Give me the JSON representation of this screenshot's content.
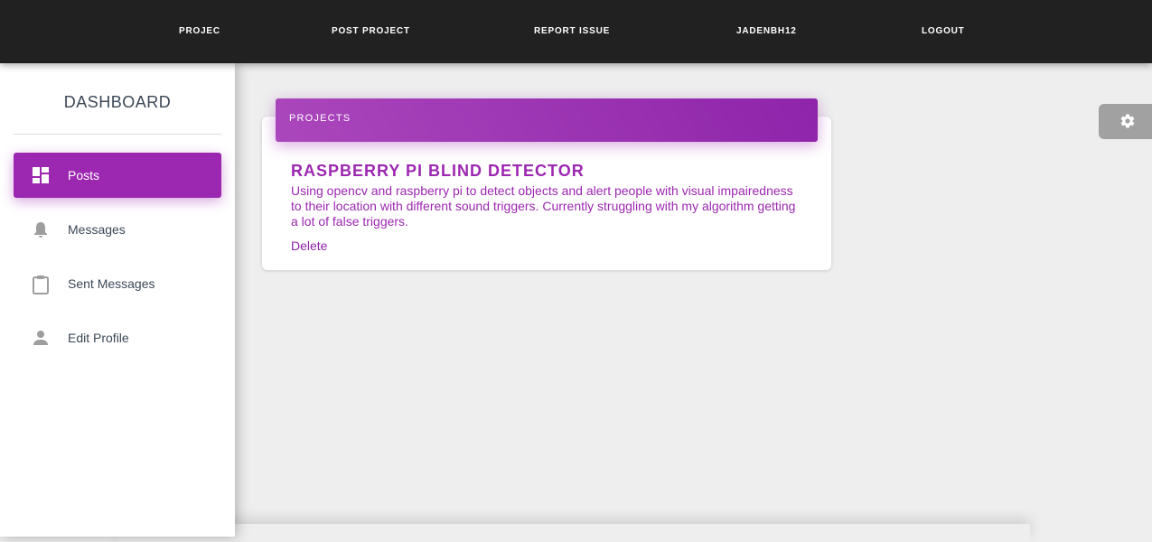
{
  "topnav": {
    "items": [
      "PROJEC",
      "POST PROJECT",
      "REPORT ISSUE",
      "JADENBH12",
      "LOGOUT"
    ]
  },
  "sidebar": {
    "title": "DASHBOARD",
    "items": [
      {
        "label": "Posts",
        "icon": "dashboard-icon",
        "active": true
      },
      {
        "label": "Messages",
        "icon": "bell-icon",
        "active": false
      },
      {
        "label": "Sent Messages",
        "icon": "clipboard-icon",
        "active": false
      },
      {
        "label": "Edit Profile",
        "icon": "person-icon",
        "active": false
      }
    ]
  },
  "main": {
    "card_header": "PROJECTS",
    "project": {
      "title": "RASPBERRY PI BLIND DETECTOR",
      "description": "Using opencv and raspberry pi to detect objects and alert people with visual impairedness to their location with different sound triggers. Currently struggling with my algorithm getting a lot of false triggers.",
      "delete_label": "Delete"
    }
  },
  "colors": {
    "accent": "#9c27b0",
    "topnav_bg": "#212121",
    "background": "#eeeeee"
  },
  "settings": {
    "icon": "gear-icon"
  }
}
